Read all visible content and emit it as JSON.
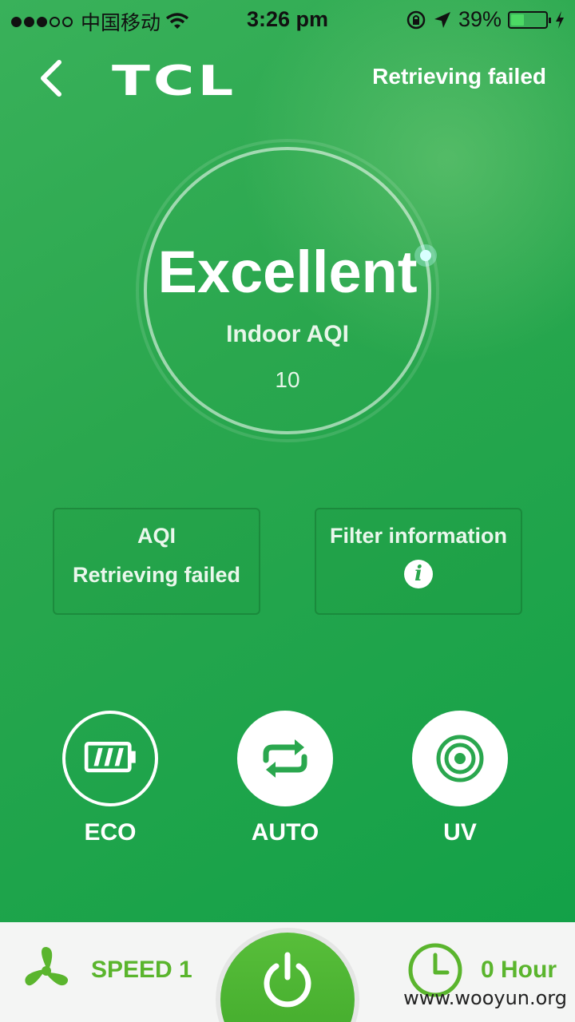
{
  "status_bar": {
    "carrier": "中国移动",
    "time": "3:26 pm",
    "battery_percent": "39%",
    "battery_level": 0.39
  },
  "header": {
    "logo": "TCL",
    "status": "Retrieving failed"
  },
  "gauge": {
    "title": "Excellent",
    "label": "Indoor AQI",
    "value": "10"
  },
  "cards": {
    "aqi": {
      "title": "AQI",
      "value": "Retrieving failed"
    },
    "filter": {
      "title": "Filter information",
      "icon": "info-icon"
    }
  },
  "modes": [
    {
      "label": "ECO",
      "icon": "battery-icon",
      "active": false
    },
    {
      "label": "AUTO",
      "icon": "repeat-icon",
      "active": true
    },
    {
      "label": "UV",
      "icon": "target-icon",
      "active": true
    }
  ],
  "bottom_bar": {
    "speed_label": "SPEED 1",
    "timer_label": "0 Hour",
    "watermark": "www.wooyun.org"
  },
  "colors": {
    "background_green": "#2aa74e",
    "accent_green": "#5ab52d",
    "power_green": "#4cb332"
  }
}
